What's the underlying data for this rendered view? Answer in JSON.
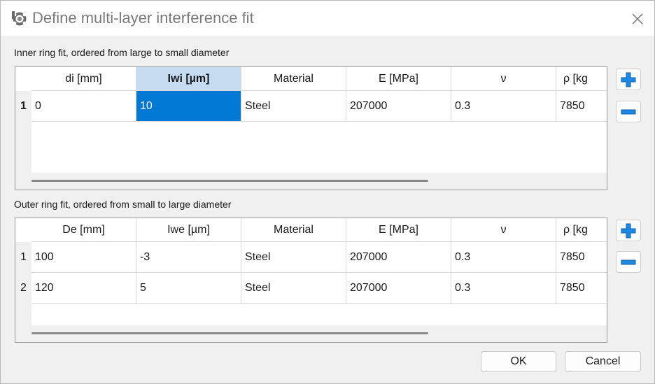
{
  "window": {
    "title": "Define multi-layer interference fit",
    "icons": {
      "app": "bearing-app-icon",
      "close": "close-icon"
    }
  },
  "inner": {
    "label": "Inner ring fit, ordered from large to small diameter",
    "columns": [
      "di [mm]",
      "Iwi [µm]",
      "Material",
      "E [MPa]",
      "ν",
      "ρ [kg"
    ],
    "selected_column": 1,
    "rows": [
      {
        "num": "1",
        "cells": [
          "0",
          "10",
          "Steel",
          "207000",
          "0.3",
          "7850"
        ]
      }
    ]
  },
  "outer": {
    "label": "Outer ring fit, ordered from small to large diameter",
    "columns": [
      "De [mm]",
      "Iwe [µm]",
      "Material",
      "E [MPa]",
      "ν",
      "ρ [kg"
    ],
    "rows": [
      {
        "num": "1",
        "cells": [
          "100",
          "-3",
          "Steel",
          "207000",
          "0.3",
          "7850"
        ]
      },
      {
        "num": "2",
        "cells": [
          "120",
          "5",
          "Steel",
          "207000",
          "0.3",
          "7850"
        ]
      }
    ]
  },
  "side_buttons": {
    "add_icon": "plus-icon",
    "remove_icon": "minus-icon",
    "color": "#1e88e5"
  },
  "buttons": {
    "ok": "OK",
    "cancel": "Cancel"
  },
  "colors": {
    "selection": "#0078d4",
    "selected_header": "#c5dcf1"
  }
}
